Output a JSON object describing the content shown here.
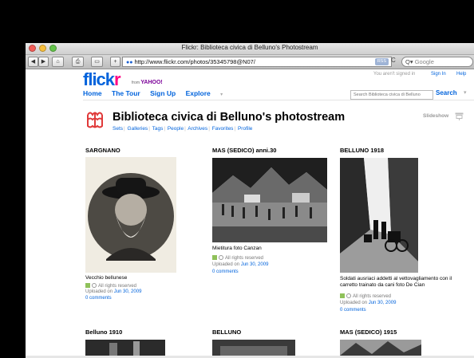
{
  "browser": {
    "window_title": "Flickr: Biblioteca civica di Belluno's Photostream",
    "url": "http://www.flickr.com/photos/35345798@N07/",
    "rss_label": "RSS",
    "reload_glyph": "C",
    "search_placeholder": "Google",
    "search_icon_glyph": "Q▾",
    "back_glyph": "◀",
    "forward_glyph": "▶",
    "home_glyph": "⌂",
    "print_glyph": "⎙",
    "bookmark_glyph": "▭",
    "add_glyph": "+"
  },
  "header": {
    "logo_part1": "flick",
    "logo_part2": "r",
    "logo_from": "from",
    "logo_yahoo": "YAHOO!",
    "nav": [
      "Home",
      "The Tour",
      "Sign Up",
      "Explore"
    ],
    "explore_arrow": "▾",
    "signed_in_text": "You aren't signed in",
    "sign_in": "Sign In",
    "help": "Help",
    "search_placeholder": "Search Biblioteca civica di Belluno",
    "search_button": "Search",
    "search_arrow": "▾"
  },
  "profile": {
    "title": "Biblioteca civica di Belluno's photostream",
    "links": [
      "Sets",
      "Galleries",
      "Tags",
      "People",
      "Archives",
      "Favorites",
      "Profile"
    ],
    "separator": "|",
    "slideshow": "Slideshow"
  },
  "photos": [
    {
      "title": "SARGNANO",
      "caption": "Vecchio bellunese",
      "license": "All rights reserved",
      "uploaded_prefix": "Uploaded on",
      "uploaded_date": "Jun 30, 2009",
      "comments": "0 comments"
    },
    {
      "title": "MAS (SEDICO) anni.30",
      "caption": "Mietitura foto Canzan",
      "license": "All rights reserved",
      "uploaded_prefix": "Uploaded on",
      "uploaded_date": "Jun 30, 2009",
      "comments": "0 comments"
    },
    {
      "title": "BELLUNO 1918",
      "caption": "Soldati ausriaci addetti al vettovagliamento con il carretto trainato da cani foto De Cian",
      "license": "All rights reserved",
      "uploaded_prefix": "Uploaded on",
      "uploaded_date": "Jun 30, 2009",
      "comments": "0 comments"
    },
    {
      "title": "Belluno 1910"
    },
    {
      "title": "BELLUNO"
    },
    {
      "title": "MAS (SEDICO) 1915"
    }
  ],
  "colors": {
    "flickr_blue": "#0063dc",
    "flickr_pink": "#ff0084",
    "license_green": "#8fc15a"
  }
}
